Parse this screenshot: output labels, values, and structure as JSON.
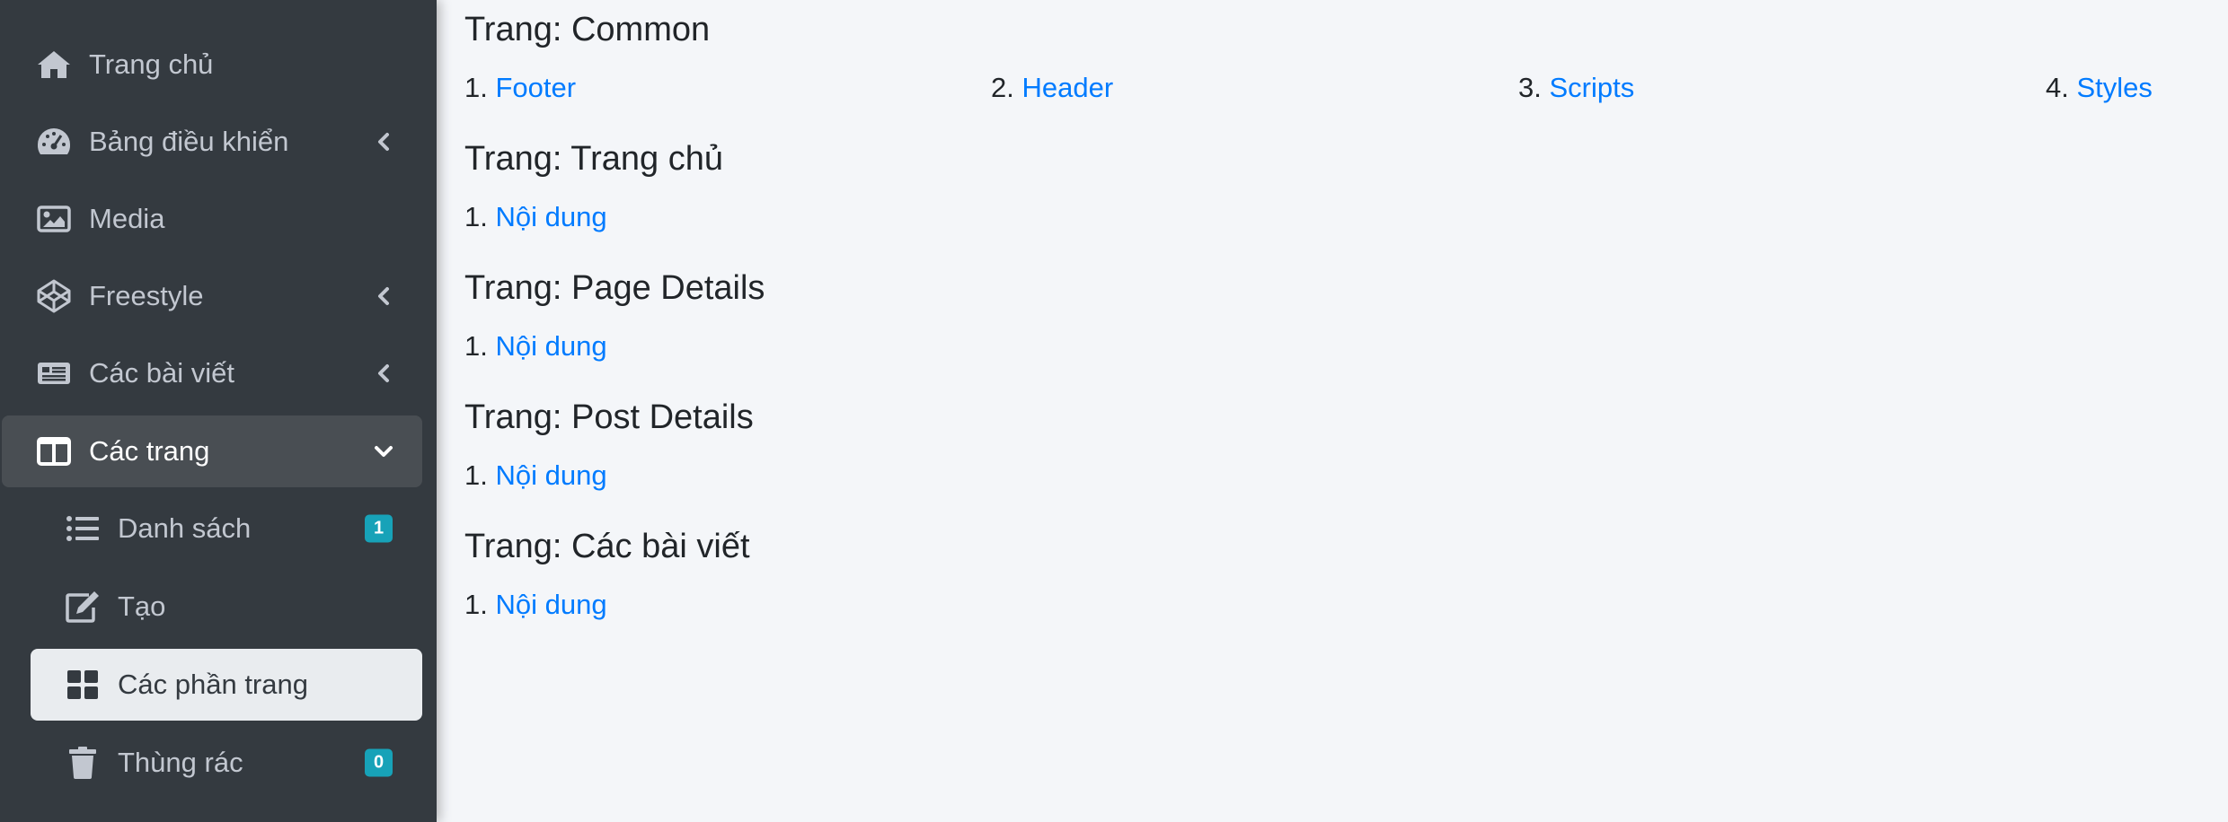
{
  "sidebar": {
    "items": [
      {
        "label": "Trang chủ",
        "icon": "home-icon"
      },
      {
        "label": "Bảng điều khiển",
        "icon": "tachometer-icon"
      },
      {
        "label": "Media",
        "icon": "image-icon"
      },
      {
        "label": "Freestyle",
        "icon": "codepen-icon"
      },
      {
        "label": "Các bài viết",
        "icon": "newspaper-icon"
      },
      {
        "label": "Các trang",
        "icon": "columns-icon"
      }
    ],
    "subitems": [
      {
        "label": "Danh sách",
        "icon": "list-icon",
        "badge": "1"
      },
      {
        "label": "Tạo",
        "icon": "edit-icon"
      },
      {
        "label": "Các phần trang",
        "icon": "th-large-icon"
      },
      {
        "label": "Thùng rác",
        "icon": "trash-icon",
        "badge": "0"
      }
    ]
  },
  "main": {
    "sections": [
      {
        "title": "Trang: Common",
        "links": [
          {
            "num": "1.",
            "label": "Footer"
          },
          {
            "num": "2.",
            "label": "Header"
          },
          {
            "num": "3.",
            "label": "Scripts"
          },
          {
            "num": "4.",
            "label": "Styles"
          }
        ]
      },
      {
        "title": "Trang: Trang chủ",
        "links": [
          {
            "num": "1.",
            "label": "Nội dung"
          }
        ]
      },
      {
        "title": "Trang: Page Details",
        "links": [
          {
            "num": "1.",
            "label": "Nội dung"
          }
        ]
      },
      {
        "title": "Trang: Post Details",
        "links": [
          {
            "num": "1.",
            "label": "Nội dung"
          }
        ]
      },
      {
        "title": "Trang: Các bài viết",
        "links": [
          {
            "num": "1.",
            "label": "Nội dung"
          }
        ]
      }
    ]
  },
  "colors": {
    "sidebar_bg": "#343a40",
    "sidebar_text": "#c2c7d0",
    "link": "#007bff",
    "badge": "#17a2b8",
    "content_bg": "#f4f6f9"
  }
}
